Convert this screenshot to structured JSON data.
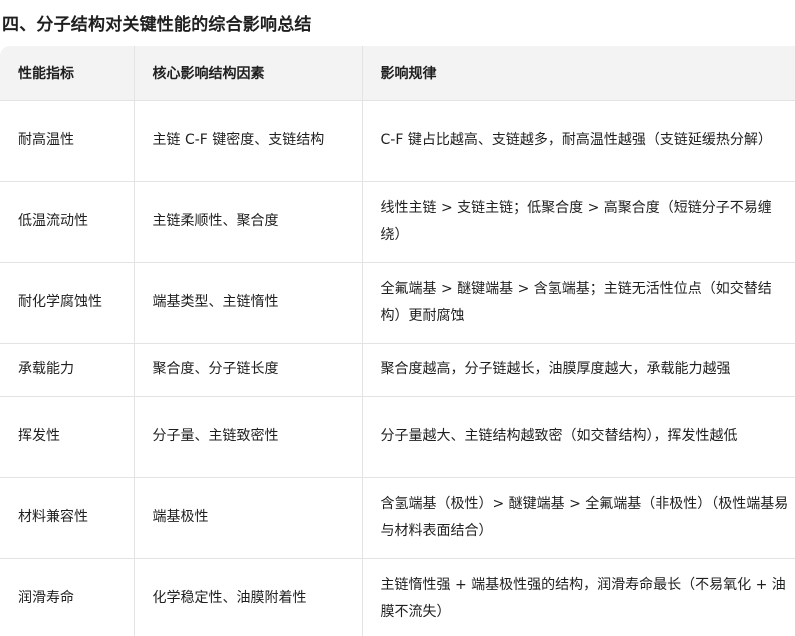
{
  "heading": "四、分子结构对关键性能的综合影响总结",
  "table": {
    "headers": [
      "性能指标",
      "核心影响结构因素",
      "影响规律"
    ],
    "rows": [
      [
        "耐高温性",
        "主链 C-F 键密度、支链结构",
        "C-F 键占比越高、支链越多，耐高温性越强（支链延缓热分解）"
      ],
      [
        "低温流动性",
        "主链柔顺性、聚合度",
        "线性主链 > 支链主链；低聚合度 > 高聚合度（短链分子不易缠绕）"
      ],
      [
        "耐化学腐蚀性",
        "端基类型、主链惰性",
        "全氟端基 > 醚键端基 > 含氢端基；主链无活性位点（如交替结构）更耐腐蚀"
      ],
      [
        "承载能力",
        "聚合度、分子链长度",
        "聚合度越高，分子链越长，油膜厚度越大，承载能力越强"
      ],
      [
        "挥发性",
        "分子量、主链致密性",
        "分子量越大、主链结构越致密（如交替结构），挥发性越低"
      ],
      [
        "材料兼容性",
        "端基极性",
        "含氢端基（极性）> 醚键端基 > 全氟端基（非极性）（极性端基易与材料表面结合）"
      ],
      [
        "润滑寿命",
        "化学稳定性、油膜附着性",
        "主链惰性强 + 端基极性强的结构，润滑寿命最长（不易氧化 + 油膜不流失）"
      ]
    ]
  }
}
